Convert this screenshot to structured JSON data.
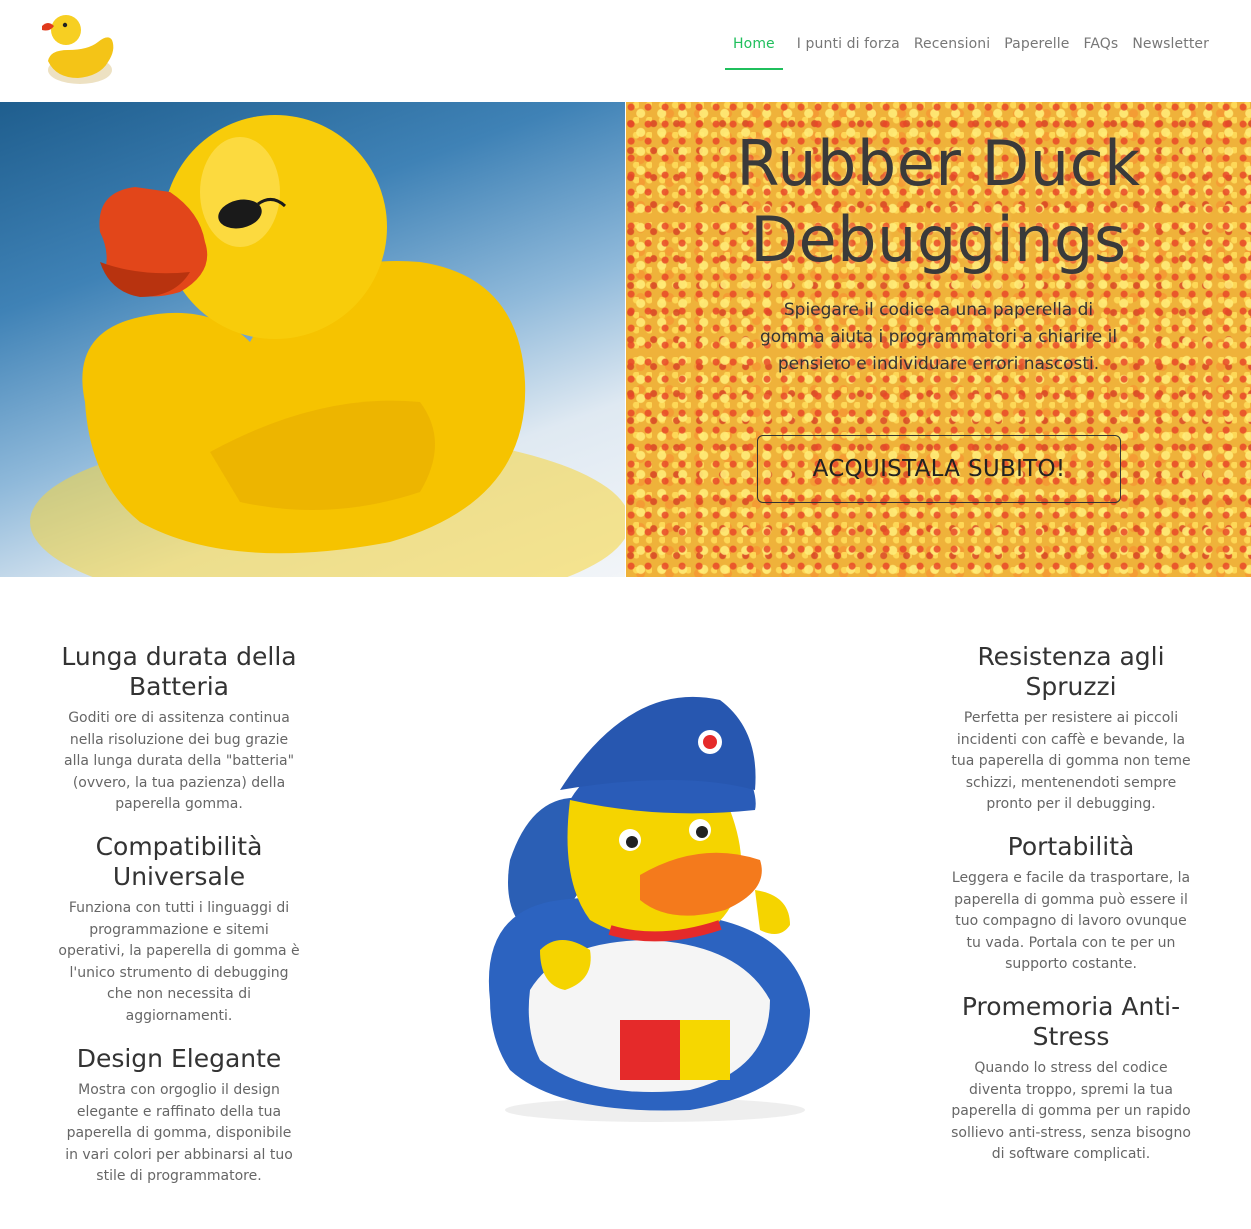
{
  "nav": {
    "items": [
      {
        "label": "Home",
        "active": true
      },
      {
        "label": "I punti di forza",
        "active": false
      },
      {
        "label": "Recensioni",
        "active": false
      },
      {
        "label": "Paperelle",
        "active": false
      },
      {
        "label": "FAQs",
        "active": false
      },
      {
        "label": "Newsletter",
        "active": false
      }
    ]
  },
  "hero": {
    "title_line1": "Rubber Duck",
    "title_line2": "Debuggings",
    "subtitle": "Spiegare il codice a una paperella di gomma aiuta i programmatori a chiarire il pensiero e individuare errori nascosti.",
    "cta_label": "ACQUISTALA SUBITO!"
  },
  "features_left": [
    {
      "title": "Lunga durata della Batteria",
      "text": "Goditi ore di assitenza continua nella risoluzione dei bug grazie alla lunga durata della \"batteria\" (ovvero, la tua pazienza) della paperella gomma."
    },
    {
      "title": "Compatibilità Universale",
      "text": "Funziona con tutti i linguaggi di programmazione e sitemi operativi, la paperella di gomma è l'unico strumento di debugging che non necessita di aggiornamenti."
    },
    {
      "title": "Design Elegante",
      "text": "Mostra con orgoglio il design elegante e raffinato della tua paperella di gomma, disponibile in vari colori per abbinarsi al tuo stile di programmatore."
    }
  ],
  "features_right": [
    {
      "title": "Resistenza agli Spruzzi",
      "text": "Perfetta per resistere ai piccoli incidenti con caffè e bevande, la tua paperella di gomma non teme schizzi, mentenendoti sempre pronto per il debugging."
    },
    {
      "title": "Portabilità",
      "text": "Leggera e facile da trasportare, la paperella di gomma può essere il tuo compagno di lavoro ovunque tu vada. Portala con te per un supporto costante."
    },
    {
      "title": "Promemoria Anti-Stress",
      "text": "Quando lo stress del codice diventa troppo, spremi la tua paperella di gomma per un rapido sollievo anti-stress, senza bisogno di software complicati."
    }
  ],
  "colors": {
    "accent": "#1fbf5c",
    "duck_yellow": "#f7c800",
    "beak_orange": "#e8501a"
  }
}
